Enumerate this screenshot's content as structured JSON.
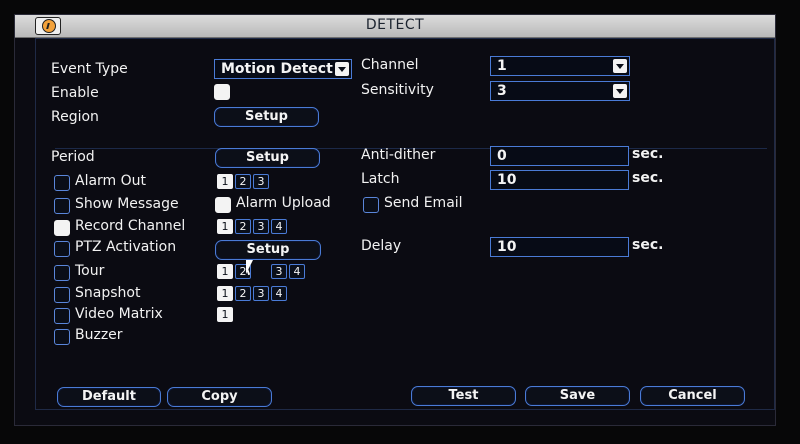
{
  "window": {
    "title": "DETECT"
  },
  "left": {
    "event_type_label": "Event Type",
    "enable_label": "Enable",
    "region_label": "Region",
    "region_button": "Setup",
    "period_label": "Period",
    "period_button": "Setup",
    "alarm_out_label": "Alarm Out",
    "alarm_out_channels": [
      "1",
      "2",
      "3"
    ],
    "show_message_label": "Show Message",
    "alarm_upload_label": "Alarm Upload",
    "send_email_label": "Send Email",
    "record_channel_label": "Record Channel",
    "record_channels": [
      "1",
      "2",
      "3",
      "4"
    ],
    "ptz_label": "PTZ Activation",
    "ptz_button": "Setup",
    "tour_label": "Tour",
    "tour_channels": [
      "1",
      "2",
      "3",
      "4"
    ],
    "snapshot_label": "Snapshot",
    "snapshot_channels": [
      "1",
      "2",
      "3",
      "4"
    ],
    "video_matrix_label": "Video Matrix",
    "video_matrix_channels": [
      "1"
    ],
    "buzzer_label": "Buzzer"
  },
  "right": {
    "event_type_value": "Motion Detect",
    "channel_label": "Channel",
    "channel_value": "1",
    "sensitivity_label": "Sensitivity",
    "sensitivity_value": "3",
    "anti_dither_label": "Anti-dither",
    "anti_dither_value": "0",
    "latch_label": "Latch",
    "latch_value": "10",
    "delay_label": "Delay",
    "delay_value": "10",
    "unit": "sec."
  },
  "footer": {
    "default": "Default",
    "copy": "Copy",
    "test": "Test",
    "save": "Save",
    "cancel": "Cancel"
  },
  "colors": {
    "accent": "#4a7bd6",
    "background": "#0b0b12",
    "titlebar": "#c8c8c8"
  }
}
